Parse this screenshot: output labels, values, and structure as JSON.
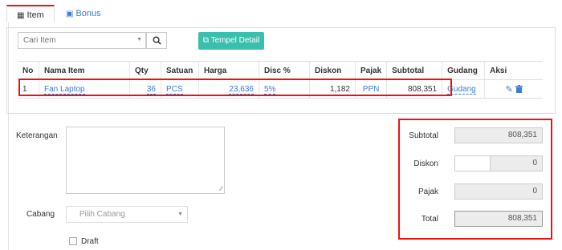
{
  "tabs": [
    {
      "label": "Item",
      "icon": "cubes-icon"
    },
    {
      "label": "Bonus",
      "icon": "gift-icon"
    }
  ],
  "search": {
    "placeholder": "Cari Item"
  },
  "toolbar": {
    "tempel_label": "Tempel Detail"
  },
  "table": {
    "headers": [
      "No",
      "Nama Item",
      "Qty",
      "Satuan",
      "Harga",
      "Disc %",
      "Diskon",
      "Pajak",
      "Subtotal",
      "Gudang",
      "Aksi"
    ],
    "rows": [
      {
        "no": "1",
        "nama": "Fan Laptop",
        "qty": "36",
        "satuan": "PCS",
        "harga": "23,636",
        "disc": "5%",
        "diskon": "1,182",
        "pajak": "PPN",
        "subtotal": "808,351",
        "gudang": "Gudang"
      }
    ]
  },
  "form": {
    "keterangan_label": "Keterangan",
    "cabang_label": "Cabang",
    "cabang_placeholder": "Pilih Cabang",
    "draft_label": "Draft"
  },
  "summary": {
    "subtotal_label": "Subtotal",
    "subtotal": "808,351",
    "diskon_label": "Diskon",
    "diskon": "0",
    "pajak_label": "Pajak",
    "pajak": "0",
    "total_label": "Total",
    "total": "808,351"
  },
  "colors": {
    "accent": "#3a7bd5",
    "highlight": "#ee1111",
    "button": "#3bbfad"
  }
}
